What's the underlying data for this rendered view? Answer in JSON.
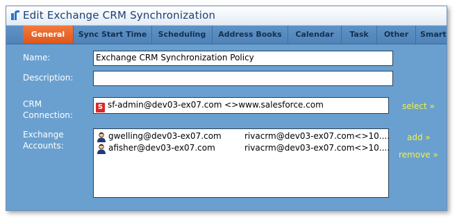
{
  "window": {
    "title": "Edit Exchange CRM Synchronization"
  },
  "tabs": [
    {
      "label": "General",
      "active": true
    },
    {
      "label": "Sync Start Time"
    },
    {
      "label": "Scheduling"
    },
    {
      "label": "Address Books"
    },
    {
      "label": "Calendar"
    },
    {
      "label": "Task"
    },
    {
      "label": "Other"
    },
    {
      "label": "Smart"
    }
  ],
  "form": {
    "name_label": "Name:",
    "name_value": "Exchange CRM Synchronization Policy",
    "description_label": "Description:",
    "description_value": "",
    "crm_label_line1": "CRM",
    "crm_label_line2": "Connection:",
    "crm_icon_text": "S",
    "crm_value": "sf-admin@dev03-ex07.com <>www.salesforce.com",
    "select_link": "select »",
    "exchange_label_line1": "Exchange",
    "exchange_label_line2": "Accounts:",
    "accounts": [
      {
        "email": "gwelling@dev03-ex07.com",
        "crm": "rivacrm@dev03-ex07.com<>10...."
      },
      {
        "email": "afisher@dev03-ex07.com",
        "crm": "rivacrm@dev03-ex07.com<>10...."
      }
    ],
    "add_link": "add »",
    "remove_link": "remove »"
  },
  "colors": {
    "panel_bg": "#6aa0cf",
    "active_tab": "#e0561a",
    "link": "#f1f24a",
    "title_text": "#1d3f73"
  }
}
